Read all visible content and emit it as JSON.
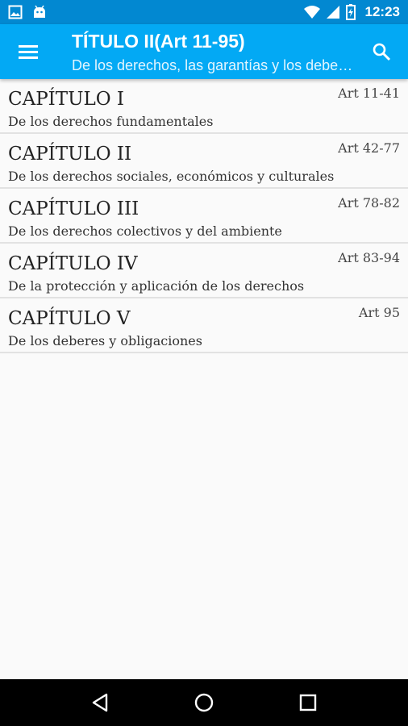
{
  "status_bar": {
    "time": "12:23",
    "left_icons": [
      "image-icon",
      "android-icon"
    ],
    "right_icons": [
      "wifi-icon",
      "signal-icon",
      "battery-icon"
    ]
  },
  "app_bar": {
    "title": "TÍTULO II(Art 11-95)",
    "subtitle": "De los derechos, las garantías y los deberes",
    "menu_icon": "menu-icon",
    "search_icon": "search-icon",
    "color": "#03a9f4",
    "status_color": "#0288d1"
  },
  "chapters": [
    {
      "title": "CAPÍTULO I",
      "range": "Art 11-41",
      "description": "De los derechos fundamentales"
    },
    {
      "title": "CAPÍTULO II",
      "range": "Art 42-77",
      "description": "De los derechos sociales, económicos y culturales"
    },
    {
      "title": "CAPÍTULO III",
      "range": "Art 78-82",
      "description": "De los derechos colectivos y del ambiente"
    },
    {
      "title": "CAPÍTULO IV",
      "range": "Art 83-94",
      "description": "De la protección y aplicación de los derechos"
    },
    {
      "title": "CAPÍTULO V",
      "range": "Art 95",
      "description": "De los deberes y obligaciones"
    }
  ],
  "nav_bar": {
    "icons": [
      "back-icon",
      "home-icon",
      "recents-icon"
    ]
  }
}
